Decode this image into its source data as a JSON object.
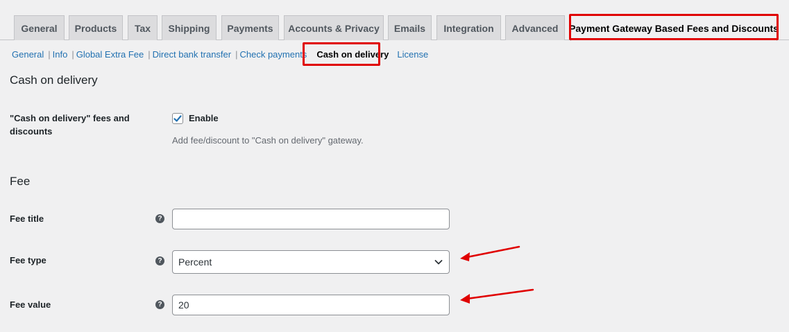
{
  "tabs": [
    {
      "label": "General"
    },
    {
      "label": "Products"
    },
    {
      "label": "Tax"
    },
    {
      "label": "Shipping"
    },
    {
      "label": "Payments"
    },
    {
      "label": "Accounts & Privacy"
    },
    {
      "label": "Emails"
    },
    {
      "label": "Integration"
    },
    {
      "label": "Advanced"
    },
    {
      "label": "Payment Gateway Based Fees and Discounts",
      "active": true
    }
  ],
  "subnav": [
    {
      "label": "General"
    },
    {
      "label": "Info"
    },
    {
      "label": "Global Extra Fee"
    },
    {
      "label": "Direct bank transfer"
    },
    {
      "label": "Check payments"
    },
    {
      "label": "Cash on delivery",
      "current": true
    },
    {
      "label": "License"
    }
  ],
  "section_title": "Cash on delivery",
  "enable_row": {
    "label_line1": "\"Cash on delivery\" fees and",
    "label_line2": "discounts",
    "checkbox_label": "Enable",
    "checked": true,
    "description": "Add fee/discount to \"Cash on delivery\" gateway."
  },
  "fee_section_title": "Fee",
  "fields": {
    "fee_title": {
      "label": "Fee title",
      "value": ""
    },
    "fee_type": {
      "label": "Fee type",
      "value": "Percent"
    },
    "fee_value": {
      "label": "Fee value",
      "value": "20"
    }
  },
  "help_glyph": "?",
  "colors": {
    "link": "#2271b1",
    "highlight": "#e00000",
    "checkbox_check": "#2271b1"
  },
  "icons": {
    "help": "question-circle-icon",
    "dropdown": "chevron-down-icon",
    "check": "checkmark-icon"
  }
}
